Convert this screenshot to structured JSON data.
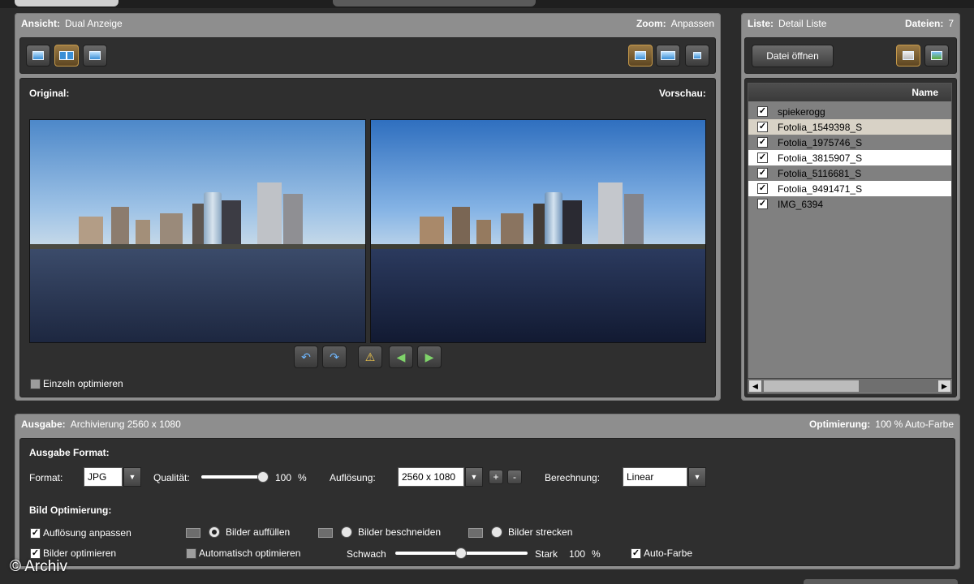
{
  "view": {
    "label": "Ansicht:",
    "value": "Dual Anzeige",
    "zoom_label": "Zoom:",
    "zoom_value": "Anpassen",
    "original_label": "Original:",
    "preview_label": "Vorschau:",
    "single_optimize": "Einzeln optimieren"
  },
  "list": {
    "label": "Liste:",
    "value": "Detail Liste",
    "files_label": "Dateien:",
    "files_count": "7",
    "open_button": "Datei öffnen",
    "column_name": "Name",
    "items": [
      {
        "name": "spiekerogg",
        "checked": true
      },
      {
        "name": "Fotolia_1549398_S",
        "checked": true
      },
      {
        "name": "Fotolia_1975746_S",
        "checked": true
      },
      {
        "name": "Fotolia_3815907_S",
        "checked": true
      },
      {
        "name": "Fotolia_5116681_S",
        "checked": true
      },
      {
        "name": "Fotolia_9491471_S",
        "checked": true
      },
      {
        "name": "IMG_6394",
        "checked": true
      }
    ]
  },
  "output": {
    "label": "Ausgabe:",
    "value": "Archivierung  2560 x 1080",
    "opt_label": "Optimierung:",
    "opt_value": "100 % Auto-Farbe",
    "format_section": "Ausgabe Format:",
    "format_label": "Format:",
    "format_value": "JPG",
    "quality_label": "Qualität:",
    "quality_value": "100",
    "quality_unit": "%",
    "quality_level": 1.0,
    "resolution_label": "Auflösung:",
    "resolution_value": "2560 x 1080",
    "calc_label": "Berechnung:",
    "calc_value": "Linear",
    "optimize_section": "Bild Optimierung:",
    "adjust_resolution": "Auflösung anpassen",
    "optimize_images": "Bilder optimieren",
    "fill": "Bilder auffüllen",
    "crop": "Bilder beschneiden",
    "stretch": "Bilder strecken",
    "auto_optimize": "Automatisch optimieren",
    "weak": "Schwach",
    "strong": "Stark",
    "strength_value": "100",
    "strength_unit": "%",
    "auto_color": "Auto-Farbe",
    "plus": "+",
    "minus": "-"
  },
  "watermark": "© Archiv"
}
